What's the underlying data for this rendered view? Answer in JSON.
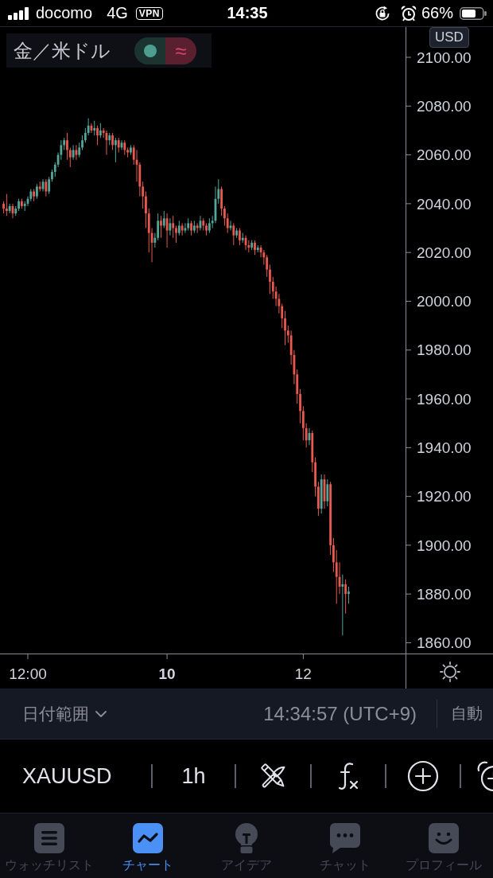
{
  "status_bar": {
    "carrier": "docomo",
    "network": "4G",
    "vpn": "VPN",
    "time": "14:35",
    "battery": "66%"
  },
  "legend": {
    "symbol": "金／米ドル",
    "delay_mark": "≈"
  },
  "chart": {
    "currency": "USD",
    "time_ticks": [
      {
        "kind": "minor"
      },
      {
        "kind": "major"
      },
      {
        "kind": "minor"
      }
    ],
    "chart_data": {
      "type": "candlestick",
      "categories": [
        null,
        null,
        null,
        null,
        null,
        null,
        null,
        null,
        "12:00",
        null,
        null,
        null,
        null,
        null,
        null,
        null,
        null,
        null,
        null,
        null,
        null,
        null,
        null,
        null,
        null,
        null,
        null,
        null,
        null,
        null,
        null,
        null,
        null,
        null,
        null,
        null,
        null,
        null,
        null,
        null,
        null,
        null,
        null,
        null,
        null,
        null,
        null,
        null,
        null,
        null,
        null,
        null,
        null,
        null,
        "10",
        null,
        null,
        null,
        null,
        null,
        null,
        null,
        null,
        null,
        null,
        null,
        null,
        null,
        null,
        null,
        null,
        null,
        null,
        null,
        null,
        null,
        null,
        null,
        null,
        null,
        null,
        null,
        null,
        null,
        null,
        null,
        null,
        null,
        null,
        null,
        null,
        null,
        null,
        null,
        null,
        null,
        null,
        null,
        null,
        "12",
        null,
        null,
        null,
        null,
        null,
        null,
        null,
        null,
        null,
        null,
        null,
        null,
        null,
        null,
        null
      ],
      "ohlc": [
        [
          2040,
          2041,
          2036,
          2038
        ],
        [
          2038,
          2044,
          2035,
          2037
        ],
        [
          2037,
          2040,
          2036,
          2039
        ],
        [
          2039,
          2040,
          2034,
          2036
        ],
        [
          2036,
          2039,
          2035,
          2038
        ],
        [
          2038,
          2042,
          2037,
          2041
        ],
        [
          2041,
          2042,
          2038,
          2039
        ],
        [
          2039,
          2041,
          2037,
          2040
        ],
        [
          2040,
          2043,
          2039,
          2042
        ],
        [
          2042,
          2046,
          2041,
          2045
        ],
        [
          2045,
          2046,
          2041,
          2043
        ],
        [
          2043,
          2048,
          2042,
          2047
        ],
        [
          2047,
          2049,
          2045,
          2046
        ],
        [
          2046,
          2050,
          2045,
          2049
        ],
        [
          2049,
          2050,
          2043,
          2045
        ],
        [
          2045,
          2051,
          2044,
          2050
        ],
        [
          2050,
          2054,
          2049,
          2053
        ],
        [
          2053,
          2057,
          2051,
          2056
        ],
        [
          2056,
          2061,
          2055,
          2060
        ],
        [
          2060,
          2066,
          2058,
          2064
        ],
        [
          2064,
          2067,
          2062,
          2066
        ],
        [
          2066,
          2069,
          2058,
          2062
        ],
        [
          2062,
          2063,
          2055,
          2059
        ],
        [
          2059,
          2064,
          2058,
          2062
        ],
        [
          2062,
          2064,
          2058,
          2060
        ],
        [
          2060,
          2065,
          2059,
          2063
        ],
        [
          2063,
          2068,
          2062,
          2066
        ],
        [
          2066,
          2071,
          2065,
          2069
        ],
        [
          2069,
          2075,
          2068,
          2072
        ],
        [
          2072,
          2073,
          2069,
          2070
        ],
        [
          2070,
          2074,
          2068,
          2071
        ],
        [
          2071,
          2072,
          2064,
          2068
        ],
        [
          2068,
          2073,
          2067,
          2070
        ],
        [
          2070,
          2071,
          2067,
          2069
        ],
        [
          2069,
          2070,
          2060,
          2066
        ],
        [
          2066,
          2069,
          2064,
          2068
        ],
        [
          2068,
          2069,
          2062,
          2064
        ],
        [
          2064,
          2067,
          2057,
          2066
        ],
        [
          2066,
          2067,
          2061,
          2063
        ],
        [
          2063,
          2066,
          2062,
          2065
        ],
        [
          2065,
          2066,
          2060,
          2062
        ],
        [
          2062,
          2063,
          2059,
          2061
        ],
        [
          2061,
          2064,
          2060,
          2063
        ],
        [
          2063,
          2064,
          2056,
          2058
        ],
        [
          2058,
          2062,
          2049,
          2056
        ],
        [
          2056,
          2057,
          2043,
          2047
        ],
        [
          2047,
          2049,
          2038,
          2043
        ],
        [
          2043,
          2045,
          2030,
          2036
        ],
        [
          2036,
          2038,
          2020,
          2028
        ],
        [
          2028,
          2030,
          2016,
          2024
        ],
        [
          2024,
          2028,
          2022,
          2026
        ],
        [
          2026,
          2036,
          2025,
          2033
        ],
        [
          2033,
          2035,
          2026,
          2031
        ],
        [
          2031,
          2037,
          2030,
          2034
        ],
        [
          2034,
          2036,
          2022,
          2029
        ],
        [
          2029,
          2034,
          2027,
          2032
        ],
        [
          2032,
          2035,
          2026,
          2030
        ],
        [
          2030,
          2031,
          2024,
          2028
        ],
        [
          2028,
          2033,
          2027,
          2031
        ],
        [
          2031,
          2032,
          2027,
          2029
        ],
        [
          2029,
          2032,
          2028,
          2030
        ],
        [
          2030,
          2034,
          2029,
          2032
        ],
        [
          2032,
          2033,
          2027,
          2029
        ],
        [
          2029,
          2033,
          2028,
          2031
        ],
        [
          2031,
          2032,
          2028,
          2030
        ],
        [
          2030,
          2035,
          2029,
          2033
        ],
        [
          2033,
          2034,
          2029,
          2031
        ],
        [
          2031,
          2032,
          2027,
          2029
        ],
        [
          2029,
          2034,
          2028,
          2032
        ],
        [
          2032,
          2035,
          2030,
          2033
        ],
        [
          2033,
          2047,
          2032,
          2042
        ],
        [
          2042,
          2050,
          2040,
          2046
        ],
        [
          2046,
          2047,
          2035,
          2038
        ],
        [
          2038,
          2039,
          2031,
          2034
        ],
        [
          2034,
          2036,
          2028,
          2030
        ],
        [
          2030,
          2033,
          2029,
          2031
        ],
        [
          2031,
          2032,
          2023,
          2027
        ],
        [
          2027,
          2030,
          2026,
          2029
        ],
        [
          2029,
          2030,
          2023,
          2025
        ],
        [
          2025,
          2028,
          2024,
          2026
        ],
        [
          2026,
          2027,
          2021,
          2023
        ],
        [
          2023,
          2025,
          2020,
          2022
        ],
        [
          2022,
          2025,
          2021,
          2024
        ],
        [
          2024,
          2025,
          2019,
          2021
        ],
        [
          2021,
          2023,
          2020,
          2022
        ],
        [
          2022,
          2023,
          2018,
          2020
        ],
        [
          2020,
          2021,
          2015,
          2018
        ],
        [
          2018,
          2019,
          2010,
          2013
        ],
        [
          2013,
          2015,
          2003,
          2008
        ],
        [
          2008,
          2010,
          2001,
          2004
        ],
        [
          2004,
          2006,
          1998,
          2001
        ],
        [
          2001,
          2003,
          1995,
          1998
        ],
        [
          1998,
          1999,
          1989,
          1993
        ],
        [
          1993,
          1996,
          1982,
          1988
        ],
        [
          1988,
          1990,
          1983,
          1986
        ],
        [
          1986,
          1988,
          1974,
          1978
        ],
        [
          1978,
          1980,
          1966,
          1970
        ],
        [
          1970,
          1972,
          1958,
          1962
        ],
        [
          1962,
          1964,
          1950,
          1955
        ],
        [
          1955,
          1957,
          1943,
          1948
        ],
        [
          1948,
          1950,
          1940,
          1943
        ],
        [
          1943,
          1948,
          1941,
          1946
        ],
        [
          1946,
          1947,
          1930,
          1934
        ],
        [
          1934,
          1936,
          1920,
          1924
        ],
        [
          1924,
          1926,
          1912,
          1915
        ],
        [
          1915,
          1929,
          1913,
          1927
        ],
        [
          1927,
          1929,
          1915,
          1918
        ],
        [
          1918,
          1927,
          1916,
          1925
        ],
        [
          1925,
          1926,
          1896,
          1900
        ],
        [
          1900,
          1903,
          1889,
          1893
        ],
        [
          1893,
          1898,
          1876,
          1887
        ],
        [
          1887,
          1893,
          1880,
          1883
        ],
        [
          1883,
          1888,
          1863,
          1884
        ],
        [
          1884,
          1886,
          1872,
          1880
        ],
        [
          1880,
          1883,
          1876,
          1881
        ]
      ],
      "ylim": [
        1855.6,
        2112.4
      ],
      "yticks": [
        {
          "value": 2100,
          "label": "2100.00"
        },
        {
          "value": 2080,
          "label": "2080.00"
        },
        {
          "value": 2060,
          "label": "2060.00"
        },
        {
          "value": 2040,
          "label": "2040.00"
        },
        {
          "value": 2020,
          "label": "2020.00"
        },
        {
          "value": 2000,
          "label": "2000.00"
        },
        {
          "value": 1980,
          "label": "1980.00"
        },
        {
          "value": 1960,
          "label": "1960.00"
        },
        {
          "value": 1940,
          "label": "1940.00"
        },
        {
          "value": 1920,
          "label": "1920.00"
        },
        {
          "value": 1900,
          "label": "1900.00"
        },
        {
          "value": 1880,
          "label": "1880.00"
        },
        {
          "value": 1860,
          "label": "1860.00"
        }
      ]
    }
  },
  "range_bar": {
    "date_range": "日付範囲",
    "clock": "14:34:57 (UTC+9)",
    "scale_mode": "自動"
  },
  "toolbar": {
    "symbol": "XAUUSD",
    "interval": "1h"
  },
  "tabs": [
    {
      "label": "ウォッチリスト",
      "selected": false
    },
    {
      "label": "チャート",
      "selected": true
    },
    {
      "label": "アイデア",
      "selected": false
    },
    {
      "label": "チャット",
      "selected": false
    },
    {
      "label": "プロフィール",
      "selected": false
    }
  ]
}
